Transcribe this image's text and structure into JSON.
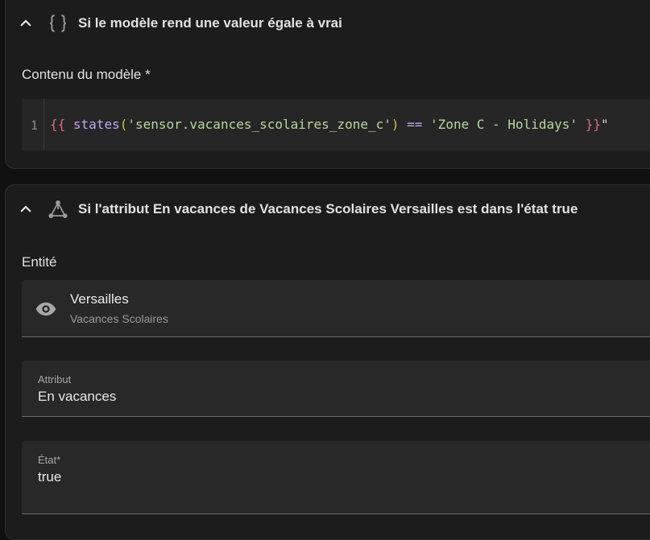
{
  "template_condition": {
    "title": "Si le modèle rend une valeur égale à vrai",
    "icon": "braces-icon",
    "content_label": "Contenu du modèle *",
    "line_number": "1",
    "code_tokens": [
      {
        "text": "{{",
        "color": "#e06c75"
      },
      {
        "text": " ",
        "color": "#dcdcdc"
      },
      {
        "text": "states",
        "color": "#c5a5f5"
      },
      {
        "text": "(",
        "color": "#d9c24a"
      },
      {
        "text": "'sensor.vacances_scolaires_zone_c'",
        "color": "#b5d99c"
      },
      {
        "text": ")",
        "color": "#d9c24a"
      },
      {
        "text": " ",
        "color": "#dcdcdc"
      },
      {
        "text": "==",
        "color": "#c5a5f5"
      },
      {
        "text": " ",
        "color": "#dcdcdc"
      },
      {
        "text": "'Zone C - Holidays'",
        "color": "#b5d99c"
      },
      {
        "text": " ",
        "color": "#dcdcdc"
      },
      {
        "text": "}}",
        "color": "#e06c75"
      },
      {
        "text": "\"",
        "color": "#dcdcdc"
      }
    ]
  },
  "state_condition": {
    "title": "Si l'attribut En vacances de Vacances Scolaires Versailles est dans l'état true",
    "icon": "state-graph-icon",
    "entity_label": "Entité",
    "entity": {
      "name": "Versailles",
      "subtitle": "Vacances Scolaires",
      "icon": "eye-icon"
    },
    "attribute": {
      "label": "Attribut",
      "value": "En vacances"
    },
    "state": {
      "label": "État*",
      "value": "true"
    }
  }
}
